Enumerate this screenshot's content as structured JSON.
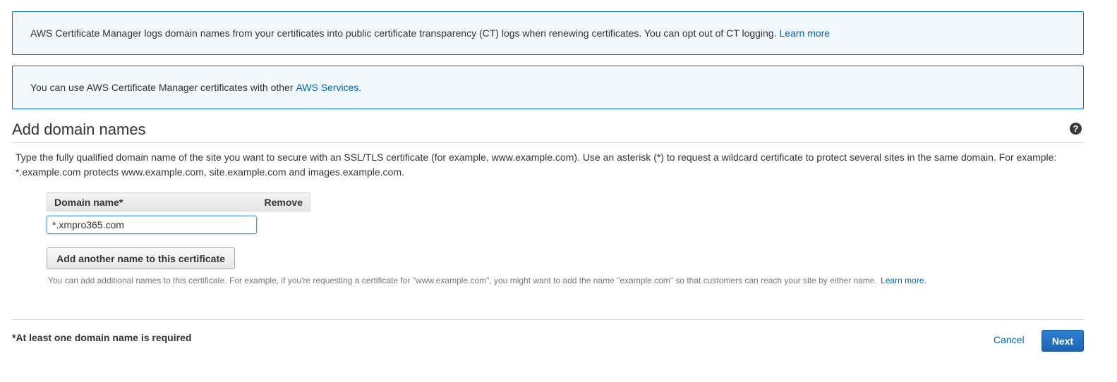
{
  "info": {
    "ct_text": "AWS Certificate Manager logs domain names from your certificates into public certificate transparency (CT) logs when renewing certificates. You can opt out of CT logging.",
    "ct_link": "Learn more",
    "services_text": "You can use AWS Certificate Manager certificates with other",
    "services_link": "AWS Services."
  },
  "section": {
    "title": "Add domain names",
    "help_icon": "?",
    "description": "Type the fully qualified domain name of the site you want to secure with an SSL/TLS certificate (for example, www.example.com). Use an asterisk (*) to request a wildcard certificate to protect several sites in the same domain. For example: *.example.com protects www.example.com, site.example.com and images.example.com."
  },
  "table": {
    "col_domain": "Domain name*",
    "col_remove": "Remove",
    "domain_value": "*.xmpro365.com"
  },
  "add": {
    "button_label": "Add another name to this certificate",
    "hint": "You can add additional names to this certificate. For example, if you're requesting a certificate for \"www.example.com\", you might want to add the name \"example.com\" so that customers can reach your site by either name.",
    "hint_link": "Learn more."
  },
  "footer": {
    "required_note": "*At least one domain name is required",
    "cancel_label": "Cancel",
    "next_label": "Next"
  },
  "colors": {
    "link": "#0066b8",
    "info_bg": "#f0f7fd",
    "info_border": "#0073bb",
    "primary_button": "#1b64b3"
  }
}
